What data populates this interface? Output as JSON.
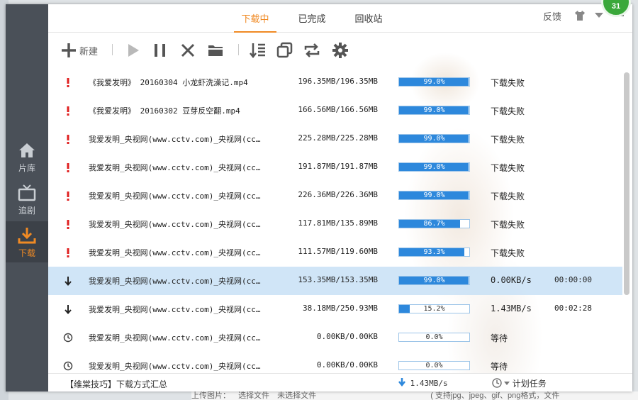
{
  "badge": "31",
  "background_page": {
    "upload_label": "上传图片：",
    "select_file": "选择文件",
    "no_file": "未选择文件",
    "formats": "( 支持jpg、jpeg、gif、png格式，文件"
  },
  "sidebar": {
    "items": [
      {
        "label": "片库",
        "icon": "home-icon"
      },
      {
        "label": "追剧",
        "icon": "tv-icon"
      },
      {
        "label": "下载",
        "icon": "download-icon"
      }
    ]
  },
  "tabs": [
    {
      "label": "下载中",
      "active": true
    },
    {
      "label": "已完成",
      "active": false
    },
    {
      "label": "回收站",
      "active": false
    }
  ],
  "window": {
    "feedback": "反馈"
  },
  "toolbar": {
    "new_label": "新建"
  },
  "colors": {
    "accent": "#f08a24",
    "progress": "#2d88dc",
    "error": "#e02020",
    "selected_row": "#c4def5"
  },
  "downloads": [
    {
      "icon": "error-icon",
      "name": "《我爱发明》 20160304 小龙虾洗澡记.mp4",
      "size": "196.35MB/196.35MB",
      "progress": 99.0,
      "pct": "99.0%",
      "status": "下载失败",
      "eta": "",
      "selected": false
    },
    {
      "icon": "error-icon",
      "name": "《我爱发明》 20160302 豆芽反空翻.mp4",
      "size": "166.56MB/166.56MB",
      "progress": 99.0,
      "pct": "99.0%",
      "status": "下载失败",
      "eta": "",
      "selected": false
    },
    {
      "icon": "error-icon",
      "name": "我爱发明_央视网(www.cctv.com)_央视网(cc…",
      "size": "225.28MB/225.28MB",
      "progress": 99.0,
      "pct": "99.0%",
      "status": "下载失败",
      "eta": "",
      "selected": false
    },
    {
      "icon": "error-icon",
      "name": "我爱发明_央视网(www.cctv.com)_央视网(cc…",
      "size": "191.87MB/191.87MB",
      "progress": 99.0,
      "pct": "99.0%",
      "status": "下载失败",
      "eta": "",
      "selected": false
    },
    {
      "icon": "error-icon",
      "name": "我爱发明_央视网(www.cctv.com)_央视网(cc…",
      "size": "226.36MB/226.36MB",
      "progress": 99.0,
      "pct": "99.0%",
      "status": "下载失败",
      "eta": "",
      "selected": false
    },
    {
      "icon": "error-icon",
      "name": "我爱发明_央视网(www.cctv.com)_央视网(cc…",
      "size": "117.81MB/135.89MB",
      "progress": 86.7,
      "pct": "86.7%",
      "status": "下载失败",
      "eta": "",
      "selected": false
    },
    {
      "icon": "error-icon",
      "name": "我爱发明_央视网(www.cctv.com)_央视网(cc…",
      "size": "111.57MB/119.60MB",
      "progress": 93.3,
      "pct": "93.3%",
      "status": "下载失败",
      "eta": "",
      "selected": false
    },
    {
      "icon": "downloading-icon",
      "name": "我爱发明_央视网(www.cctv.com)_央视网(cc…",
      "size": "153.35MB/153.35MB",
      "progress": 99.0,
      "pct": "99.0%",
      "status": "0.00KB/s",
      "eta": "00:00:00",
      "selected": true
    },
    {
      "icon": "downloading-icon",
      "name": "我爱发明_央视网(www.cctv.com)_央视网(cc…",
      "size": "38.18MB/250.93MB",
      "progress": 15.2,
      "pct": "15.2%",
      "status": "1.43MB/s",
      "eta": "00:02:28",
      "selected": false
    },
    {
      "icon": "clock-icon",
      "name": "我爱发明_央视网(www.cctv.com)_央视网(cc…",
      "size": "0.00KB/0.00KB",
      "progress": 0.0,
      "pct": "0.0%",
      "status": "等待",
      "eta": "",
      "selected": false
    },
    {
      "icon": "clock-icon",
      "name": "我爱发明_央视网(www.cctv.com)_央视网(cc…",
      "size": "0.00KB/0.00KB",
      "progress": 0.0,
      "pct": "0.0%",
      "status": "等待",
      "eta": "",
      "selected": false
    }
  ],
  "statusbar": {
    "tip": "【维棠技巧】下载方式汇总",
    "speed": "1.43MB/s",
    "schedule": "计划任务"
  }
}
